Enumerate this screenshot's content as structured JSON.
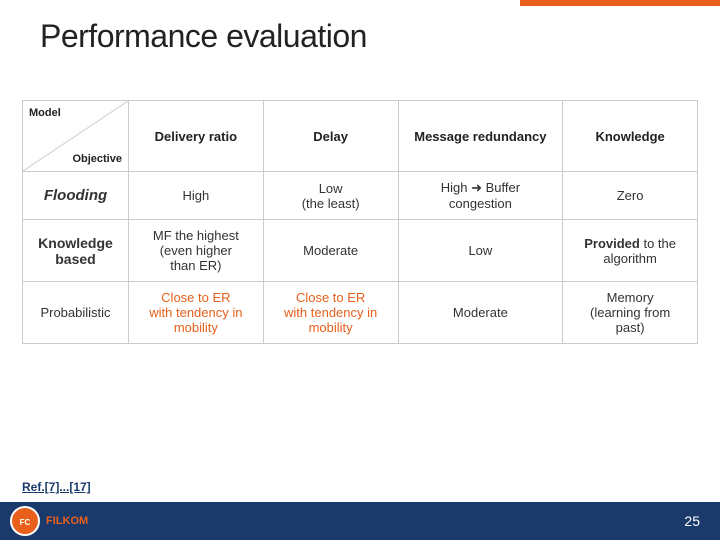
{
  "page": {
    "title": "Performance evaluation",
    "page_number": "25",
    "ref_text": "Ref.[7]...[17]"
  },
  "table": {
    "headers": {
      "model_label": "Model",
      "objective_label": "Objective",
      "col1": "Delivery ratio",
      "col2": "Delay",
      "col3": "Message redundancy",
      "col4": "Knowledge"
    },
    "rows": [
      {
        "name": "Flooding",
        "col1": "High",
        "col2_line1": "Low",
        "col2_line2": "(the least)",
        "col3_line1": "High",
        "col3_line2": "Buffer congestion",
        "col4": "Zero"
      },
      {
        "name_line1": "Knowledge",
        "name_line2": "based",
        "col1_line1": "MF the highest",
        "col1_line2": "(even higher",
        "col1_line3": "than ER)",
        "col2": "Moderate",
        "col3": "Low",
        "col4_line1": "Provided",
        "col4_line2": "to the algorithm"
      },
      {
        "name": "Probabilistic",
        "col1_line1": "Close to ER",
        "col1_line2": "with tendency in",
        "col1_line3": "mobility",
        "col2_line1": "Close to ER",
        "col2_line2": "with tendency in",
        "col2_line3": "mobility",
        "col3": "Moderate",
        "col4_line1": "Memory",
        "col4_line2": "(learning from",
        "col4_line3": "past)"
      }
    ]
  }
}
